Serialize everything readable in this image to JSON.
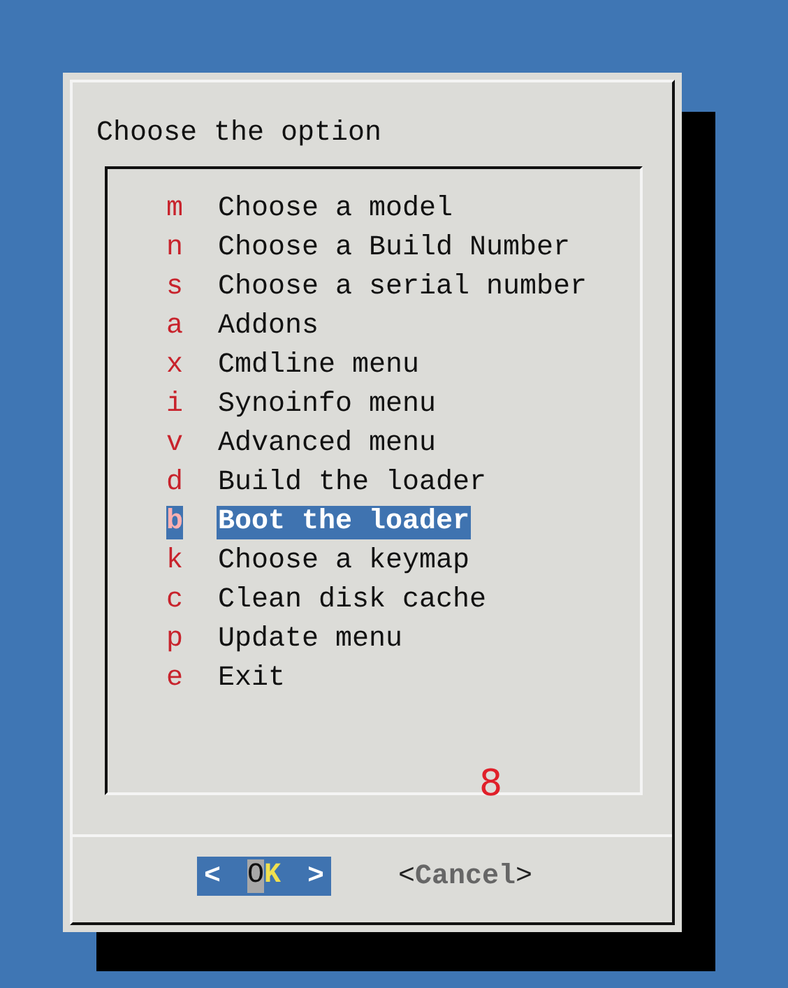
{
  "dialog": {
    "prompt": "Choose the option",
    "menu": [
      {
        "key": "m",
        "label": "Choose a model",
        "selected": false
      },
      {
        "key": "n",
        "label": "Choose a Build Number",
        "selected": false
      },
      {
        "key": "s",
        "label": "Choose a serial number",
        "selected": false
      },
      {
        "key": "a",
        "label": "Addons",
        "selected": false
      },
      {
        "key": "x",
        "label": "Cmdline menu",
        "selected": false
      },
      {
        "key": "i",
        "label": "Synoinfo menu",
        "selected": false
      },
      {
        "key": "v",
        "label": "Advanced menu",
        "selected": false
      },
      {
        "key": "d",
        "label": "Build the loader",
        "selected": false
      },
      {
        "key": "b",
        "label": "Boot the loader",
        "selected": true
      },
      {
        "key": "k",
        "label": "Choose a keymap",
        "selected": false
      },
      {
        "key": "c",
        "label": "Clean disk cache",
        "selected": false
      },
      {
        "key": "p",
        "label": "Update menu",
        "selected": false
      },
      {
        "key": "e",
        "label": "Exit",
        "selected": false
      }
    ],
    "annotation": "8",
    "buttons": [
      {
        "open": "<",
        "label": "OK",
        "close": ">",
        "selected": true
      },
      {
        "open": "<",
        "label": "Cancel",
        "close": ">",
        "selected": false
      }
    ]
  }
}
